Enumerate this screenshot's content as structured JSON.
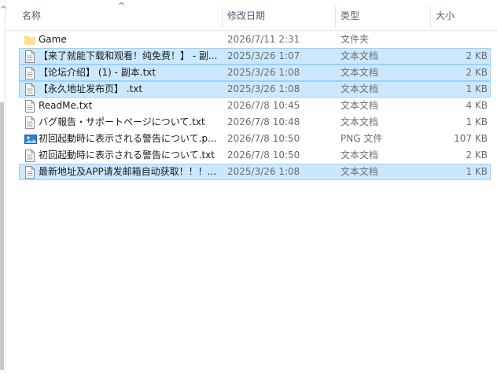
{
  "window": {
    "left_scroll_arrow": "^",
    "sort_indicator": "^"
  },
  "columns": {
    "name": "名称",
    "date": "修改日期",
    "type": "类型",
    "size": "大小"
  },
  "rows": [
    {
      "name": "Game",
      "date": "2026/7/11 2:31",
      "type": "文件夹",
      "size": "",
      "icon": "folder-icon",
      "selected": false
    },
    {
      "name": "【来了就能下载和观看！纯免费！】 - 副...",
      "date": "2025/3/26 1:07",
      "type": "文本文档",
      "size": "2 KB",
      "icon": "text-file-icon",
      "selected": true
    },
    {
      "name": "【论坛介绍】 (1) - 副本.txt",
      "date": "2025/3/26 1:08",
      "type": "文本文档",
      "size": "2 KB",
      "icon": "text-file-icon",
      "selected": true
    },
    {
      "name": "【永久地址发布页】 .txt",
      "date": "2025/3/26 1:08",
      "type": "文本文档",
      "size": "1 KB",
      "icon": "text-file-icon",
      "selected": true
    },
    {
      "name": "ReadMe.txt",
      "date": "2026/7/8 10:45",
      "type": "文本文档",
      "size": "4 KB",
      "icon": "text-file-icon",
      "selected": false
    },
    {
      "name": "バグ報告・サポートページについて.txt",
      "date": "2026/7/8 10:48",
      "type": "文本文档",
      "size": "1 KB",
      "icon": "text-file-icon",
      "selected": false
    },
    {
      "name": "初回起動時に表示される警告について.p...",
      "date": "2026/7/8 10:50",
      "type": "PNG 文件",
      "size": "107 KB",
      "icon": "image-file-icon",
      "selected": false
    },
    {
      "name": "初回起動時に表示される警告について.txt",
      "date": "2026/7/8 10:50",
      "type": "文本文档",
      "size": "2 KB",
      "icon": "text-file-icon",
      "selected": false
    },
    {
      "name": "最新地址及APP请发邮箱自动获取！！！...",
      "date": "2025/3/26 1:08",
      "type": "文本文档",
      "size": "1 KB",
      "icon": "text-file-icon",
      "selected": true
    }
  ],
  "colors": {
    "selection_bg": "#cce8ff",
    "selection_border": "#99d1ff",
    "header_text": "#4c607a",
    "folder": "#f8d775"
  }
}
